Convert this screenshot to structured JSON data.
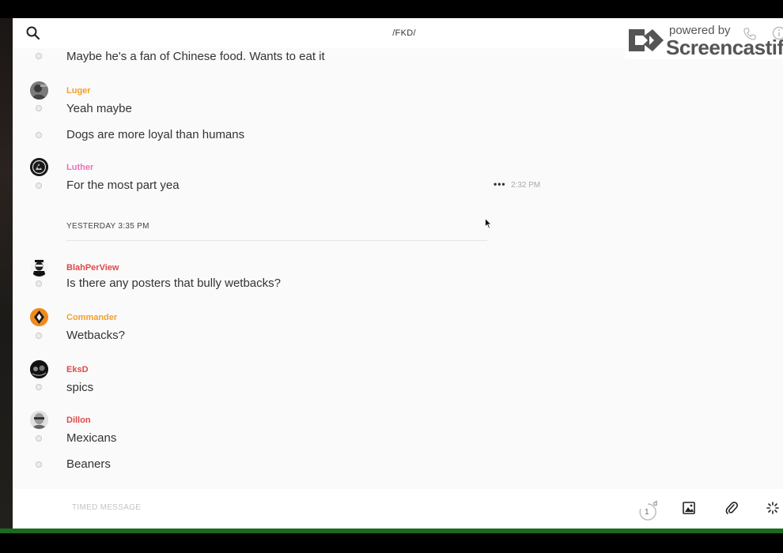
{
  "header": {
    "channel": "/FKD/",
    "search_icon": "search-icon"
  },
  "watermark": {
    "powered": "powered by",
    "brand": "Screencastify"
  },
  "messages": [
    {
      "text": "Maybe he's a fan of Chinese food. Wants to eat it"
    },
    {
      "user": "Luger",
      "user_color": "#f0a030",
      "text": "Yeah maybe"
    },
    {
      "text": "Dogs are more loyal than humans"
    },
    {
      "user": "Luther",
      "user_color": "#f070b8",
      "text": "For the most part yea",
      "time": "2:32 PM"
    },
    {
      "user": "BlahPerView",
      "user_color": "#e04848",
      "text": "Is there any posters that bully wetbacks?"
    },
    {
      "user": "Commander",
      "user_color": "#f0a030",
      "text": "Wetbacks?"
    },
    {
      "user": "EksD",
      "user_color": "#e04848",
      "text": "spics"
    },
    {
      "user": "Dillon",
      "user_color": "#e04848",
      "text": "Mexicans"
    },
    {
      "text": "Beaners"
    }
  ],
  "more_icon_text": "•••",
  "day_separator": "YESTERDAY 3:35 PM",
  "compose": {
    "placeholder": "TIMED MESSAGE",
    "timer_value": "1",
    "timer_unit": "d"
  }
}
